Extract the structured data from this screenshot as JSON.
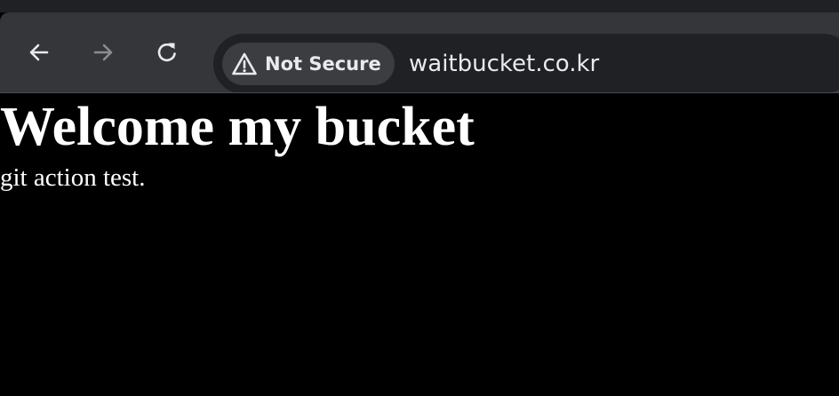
{
  "browser": {
    "toolbar": {
      "back_icon": "arrow-left-icon",
      "forward_icon": "arrow-right-icon",
      "reload_icon": "reload-icon",
      "forward_enabled": false
    },
    "omnibox": {
      "security_icon": "warning-triangle-icon",
      "security_label": "Not Secure",
      "url": "waitbucket.co.kr"
    },
    "colors": {
      "frame": "#202124",
      "toolbar": "#35363a",
      "omnibox": "#202124",
      "chip": "#3c3d41",
      "text": "#e8eaed",
      "disabled_icon": "#8b8c8f"
    }
  },
  "page": {
    "heading": "Welcome my bucket",
    "text": "git action test.",
    "background": "#000000",
    "foreground": "#ffffff"
  }
}
